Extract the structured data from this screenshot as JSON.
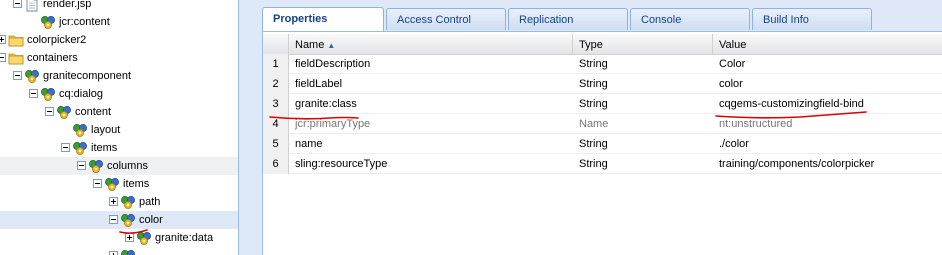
{
  "tree": [
    {
      "label": "render.jsp",
      "icon": "file-icon",
      "toggle": "minus",
      "level": 0
    },
    {
      "label": "jcr:content",
      "icon": "node-icon",
      "toggle": "none",
      "level": 1
    },
    {
      "label": "colorpicker2",
      "icon": "folder-icon",
      "toggle": "plus",
      "level": -1
    },
    {
      "label": "containers",
      "icon": "folder-icon",
      "toggle": "minus",
      "level": -1
    },
    {
      "label": "granitecomponent",
      "icon": "node-icon",
      "toggle": "minus",
      "level": 0
    },
    {
      "label": "cq:dialog",
      "icon": "node-icon",
      "toggle": "minus",
      "level": 1
    },
    {
      "label": "content",
      "icon": "node-icon",
      "toggle": "minus",
      "level": 2
    },
    {
      "label": "layout",
      "icon": "node-icon",
      "toggle": "none",
      "level": 3
    },
    {
      "label": "items",
      "icon": "node-icon",
      "toggle": "minus",
      "level": 3
    },
    {
      "label": "columns",
      "icon": "node-icon",
      "toggle": "minus",
      "level": 4,
      "state": "hover"
    },
    {
      "label": "items",
      "icon": "node-icon",
      "toggle": "minus",
      "level": 5
    },
    {
      "label": "path",
      "icon": "node-icon",
      "toggle": "plus",
      "level": 6
    },
    {
      "label": "color",
      "icon": "node-icon",
      "toggle": "minus",
      "level": 6,
      "state": "selected"
    },
    {
      "label": "granite:data",
      "icon": "node-icon",
      "toggle": "plus",
      "level": 7
    },
    {
      "label": "",
      "icon": "node-icon",
      "toggle": "plus",
      "level": 6
    }
  ],
  "tabs": [
    "Properties",
    "Access Control",
    "Replication",
    "Console",
    "Build Info"
  ],
  "active_tab": "Properties",
  "grid": {
    "columns": [
      "Name",
      "Type",
      "Value"
    ],
    "sort_indicator": "▲",
    "rows": [
      {
        "num": "1",
        "name": "fieldDescription",
        "type": "String",
        "value": "Color",
        "dim": false
      },
      {
        "num": "2",
        "name": "fieldLabel",
        "type": "String",
        "value": "color",
        "dim": false
      },
      {
        "num": "3",
        "name": "granite:class",
        "type": "String",
        "value": "cqgems-customizingfield-bind",
        "dim": false
      },
      {
        "num": "4",
        "name": "jcr:primaryType",
        "type": "Name",
        "value": "nt:unstructured",
        "dim": true
      },
      {
        "num": "5",
        "name": "name",
        "type": "String",
        "value": "./color",
        "dim": false
      },
      {
        "num": "6",
        "name": "sling:resourceType",
        "type": "String",
        "value": "training/components/colorpicker",
        "dim": false
      }
    ]
  },
  "colors": {
    "panel_bg": "#dfe8f6",
    "tab_text": "#15428b",
    "annotation": "#e00000",
    "folder": "#f3c744"
  }
}
